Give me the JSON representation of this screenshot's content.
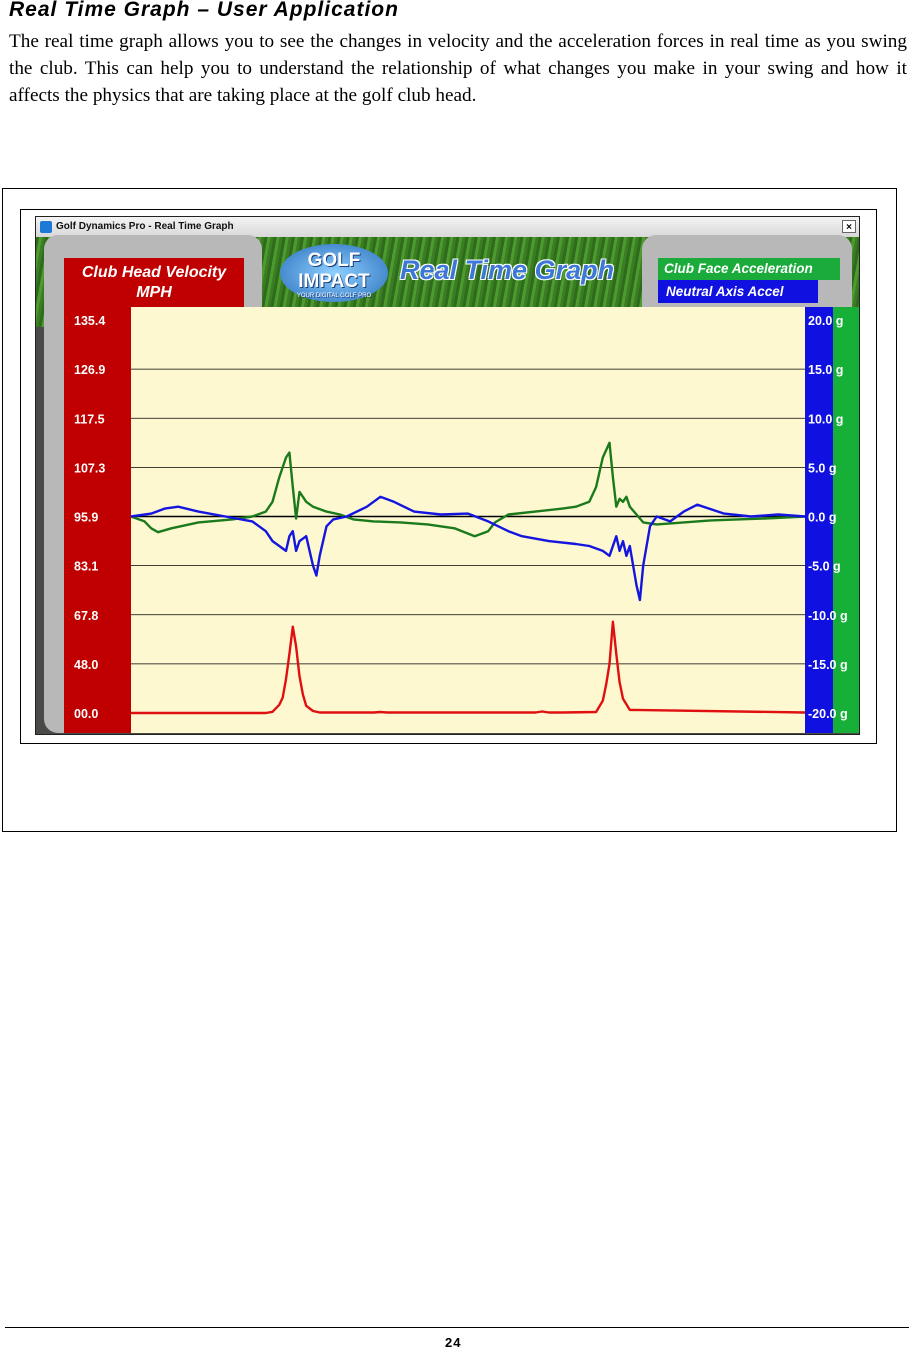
{
  "heading": "Real Time Graph – User Application",
  "intro_text": "The real time graph allows you to see the changes in velocity and the acceleration forces in real time as you swing the club. This can help you to understand the relationship of what changes you make in your swing and how it affects the physics that are taking place at the golf club head.",
  "app": {
    "window_title": "Golf Dynamics Pro - Real Time Graph",
    "close_glyph": "×",
    "logo_line1": "GOLF",
    "logo_line2": "IMPACT",
    "logo_tagline": "YOUR DIGITAL GOLF PRO",
    "graph_title": "Real Time Graph",
    "left_label_line1": "Club Head Velocity",
    "left_label_line2": "MPH",
    "right_label_top": "Club Face Acceleration",
    "right_label_bottom": "Neutral Axis Accel"
  },
  "chart_data": {
    "type": "line",
    "left_axis": {
      "label": "Club Head Velocity MPH",
      "ticks": [
        "135.4",
        "126.9",
        "117.5",
        "107.3",
        "95.9",
        "83.1",
        "67.8",
        "48.0",
        "00.0"
      ]
    },
    "right_axis": {
      "label": "Club Face Acceleration / Neutral Axis Accel",
      "ticks": [
        "20.0 g",
        "15.0 g",
        "10.0 g",
        "5.0 g",
        "0.0 g",
        "-5.0 g",
        "-10.0 g",
        "-15.0 g",
        "-20.0 g"
      ],
      "range": [
        -20,
        20
      ]
    },
    "x_range": [
      0,
      100
    ],
    "grid": true,
    "colors": {
      "plot_background": "#fdf8d0",
      "velocity": "#e01010",
      "club_face": "#1b7a1b",
      "neutral_axis": "#1515e0",
      "left_band": "#c00000",
      "right_band_blue": "#1010e0",
      "right_band_green": "#16b038"
    },
    "series": [
      {
        "name": "Club Head Velocity",
        "axis": "left",
        "x": [
          0,
          20,
          21,
          22,
          22.5,
          23,
          23.5,
          24,
          24.5,
          25,
          25.5,
          26,
          27,
          28,
          36,
          37,
          38,
          60,
          61,
          62,
          64,
          69,
          70,
          70.5,
          71,
          71.5,
          72,
          72.5,
          73,
          74,
          100
        ],
        "y": [
          0,
          0,
          1.2,
          8,
          15,
          33,
          52,
          63,
          55,
          36,
          18,
          7,
          2,
          0.5,
          0.5,
          1,
          0.5,
          0.5,
          1.5,
          0.5,
          0.5,
          1,
          12,
          28,
          48,
          65,
          52,
          30,
          14,
          3,
          0.5
        ]
      },
      {
        "name": "Club Face Acceleration",
        "axis": "right",
        "x": [
          0,
          2,
          3,
          4,
          6,
          10,
          15,
          18,
          20,
          21,
          22,
          23,
          23.5,
          24,
          24.5,
          25,
          25.5,
          26,
          27,
          29,
          31,
          33,
          36,
          40,
          44,
          48,
          51,
          53,
          54,
          56,
          60,
          64,
          66,
          68,
          69,
          70,
          71,
          71.5,
          72,
          72.5,
          73,
          73.5,
          74,
          75,
          76,
          78,
          82,
          86,
          90,
          94,
          100
        ],
        "y": [
          0,
          -0.5,
          -1.2,
          -1.6,
          -1.2,
          -0.6,
          -0.3,
          0,
          0.5,
          1.5,
          4,
          6,
          6.5,
          3,
          -0.2,
          2.5,
          2,
          1.5,
          1,
          0.5,
          0.2,
          -0.3,
          -0.5,
          -0.6,
          -0.8,
          -1.2,
          -2,
          -1.5,
          -0.6,
          0.2,
          0.5,
          0.8,
          1,
          1.5,
          3,
          6,
          7.5,
          4,
          1,
          1.8,
          1.5,
          2,
          1,
          0.2,
          -0.6,
          -0.8,
          -0.6,
          -0.4,
          -0.3,
          -0.2,
          0
        ]
      },
      {
        "name": "Neutral Axis Accel",
        "axis": "right",
        "x": [
          0,
          3,
          5,
          7,
          10,
          14,
          18,
          20,
          21,
          22,
          23,
          23.5,
          24,
          24.5,
          25,
          26,
          27,
          27.5,
          28,
          29,
          30,
          32,
          35,
          37,
          39,
          42,
          46,
          50,
          53,
          56,
          58,
          62,
          66,
          68,
          70,
          71,
          72,
          72.5,
          73,
          73.5,
          74,
          75,
          75.5,
          76,
          77,
          78,
          80,
          82,
          84,
          88,
          92,
          96,
          100
        ],
        "y": [
          0,
          0.3,
          0.8,
          1,
          0.5,
          0,
          -0.5,
          -1.5,
          -2.5,
          -3,
          -3.5,
          -2,
          -1.5,
          -3.5,
          -2.5,
          -2,
          -5,
          -6,
          -4,
          -1,
          -0.3,
          0,
          1,
          2,
          1.5,
          0.5,
          0.2,
          0.3,
          -0.5,
          -1.5,
          -2,
          -2.5,
          -2.8,
          -3,
          -3.5,
          -4,
          -2,
          -3.5,
          -2.5,
          -4,
          -3,
          -7,
          -8.5,
          -5,
          -1,
          0,
          -0.5,
          0.5,
          1.2,
          0.3,
          0,
          0.2,
          0
        ]
      }
    ]
  },
  "page_number": "24"
}
